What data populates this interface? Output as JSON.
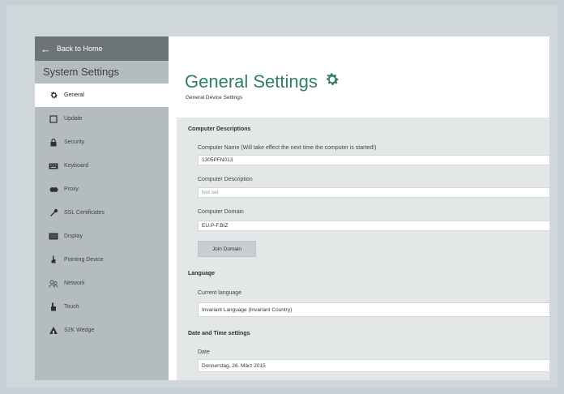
{
  "sidebar": {
    "back_label": "Back to Home",
    "title": "System Settings",
    "items": [
      {
        "label": "General",
        "icon": "gear-icon",
        "active": true
      },
      {
        "label": "Update",
        "icon": "update-icon"
      },
      {
        "label": "Security",
        "icon": "lock-icon"
      },
      {
        "label": "Keyboard",
        "icon": "keyboard-icon"
      },
      {
        "label": "Proxy",
        "icon": "proxy-icon"
      },
      {
        "label": "SSL Certificates",
        "icon": "key-icon"
      },
      {
        "label": "Display",
        "icon": "display-icon"
      },
      {
        "label": "Pointing Device",
        "icon": "pointer-icon"
      },
      {
        "label": "Network",
        "icon": "network-icon"
      },
      {
        "label": "Touch",
        "icon": "touch-icon"
      },
      {
        "label": "S2K Wedge",
        "icon": "wedge-icon"
      }
    ]
  },
  "main": {
    "title": "General Settings",
    "subtitle": "General Device Settings",
    "computer_section": {
      "heading": "Computer Descriptions",
      "name_label": "Computer Name (Will take effect the next time the computer is started!)",
      "name_value": "1305PFN013",
      "description_label": "Computer Description",
      "description_placeholder": "Not set",
      "domain_label": "Computer Domain",
      "domain_value": "EU.P-F.BIZ",
      "join_button": "Join Domain"
    },
    "language_section": {
      "heading": "Language",
      "current_label": "Current language",
      "current_value": "Invariant Language (Invariant Country)"
    },
    "datetime_section": {
      "heading": "Date and Time settings",
      "date_label": "Date",
      "date_value": "Donnerstag, 26. März 2015"
    }
  },
  "colors": {
    "accent": "#2f8062",
    "sidebar_bg": "#b5bcbf",
    "back_bar_bg": "#6d7478",
    "panel_bg": "#e4e7e8"
  }
}
